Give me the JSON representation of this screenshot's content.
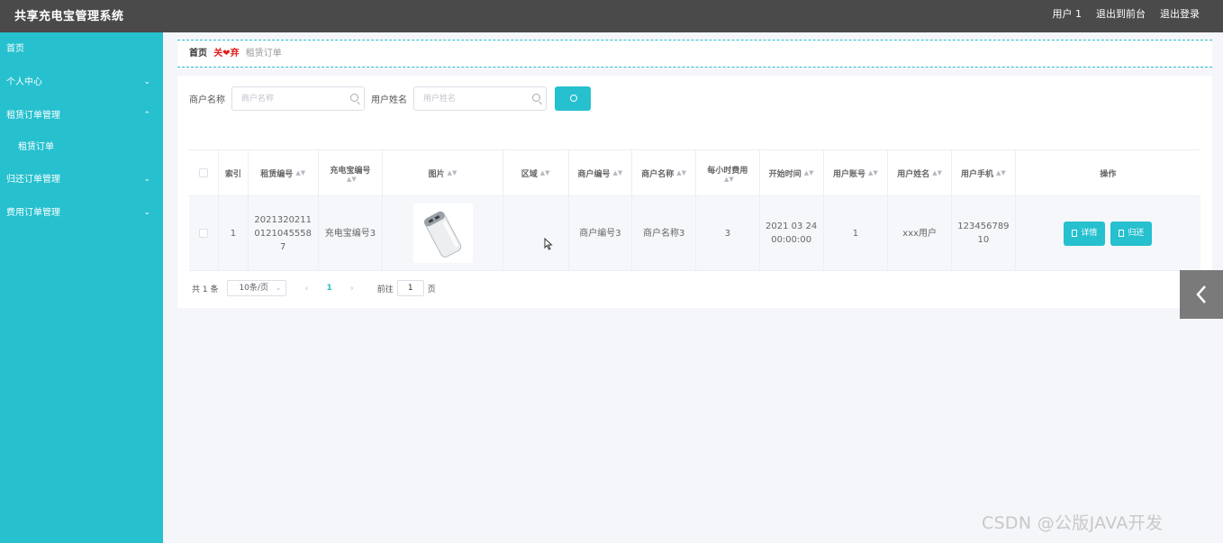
{
  "header": {
    "app_title": "共享充电宝管理系统",
    "user_label": "用户 1",
    "back_to_front": "退出到前台",
    "logout": "退出登录"
  },
  "sidebar": {
    "items": [
      {
        "label": "首页",
        "has_children": false
      },
      {
        "label": "个人中心",
        "has_children": true,
        "expanded": false
      },
      {
        "label": "租赁订单管理",
        "has_children": true,
        "expanded": true
      },
      {
        "label": "租赁订单",
        "sub": true
      },
      {
        "label": "归还订单管理",
        "has_children": true,
        "expanded": false
      },
      {
        "label": "费用订单管理",
        "has_children": true,
        "expanded": false
      }
    ]
  },
  "breadcrumb": {
    "home": "首页",
    "separator": "关❤弃",
    "current": "租赁订单"
  },
  "search": {
    "merchant_label": "商户名称",
    "merchant_placeholder": "商户名称",
    "user_label": "用户姓名",
    "user_placeholder": "用户姓名",
    "button_icon": "search-icon"
  },
  "table": {
    "headers": {
      "index": "索引",
      "rent_no": "租赁编号",
      "bank_no": "充电宝编号",
      "picture": "图片",
      "area": "区域",
      "merchant_no": "商户编号",
      "merchant_name": "商户名称",
      "hourly_fee": "每小时费用",
      "start_time": "开始时间",
      "user_account": "用户账号",
      "user_name": "用户姓名",
      "user_phone": "用户手机",
      "actions": "操作"
    },
    "rows": [
      {
        "index": "1",
        "rent_no": "202132021101210455587",
        "bank_no": "充电宝编号3",
        "area": "",
        "merchant_no": "商户编号3",
        "merchant_name": "商户名称3",
        "hourly_fee": "3",
        "start_time": "2021 03 24 00:00:00",
        "user_account": "1",
        "user_name": "xxx用户",
        "user_phone": "12345678910",
        "detail_label": "详情",
        "return_label": "归还"
      }
    ]
  },
  "pagination": {
    "total": "共 1 条",
    "page_size": "10条/页",
    "current_page": "1",
    "goto_prefix": "前往",
    "goto_value": "1",
    "goto_suffix": "页"
  },
  "watermark": "CSDN @公版JAVA开发",
  "colors": {
    "accent": "#26c0cf",
    "topbar": "#4a4a4a",
    "breadcrumb_separator": "#e0211f"
  }
}
